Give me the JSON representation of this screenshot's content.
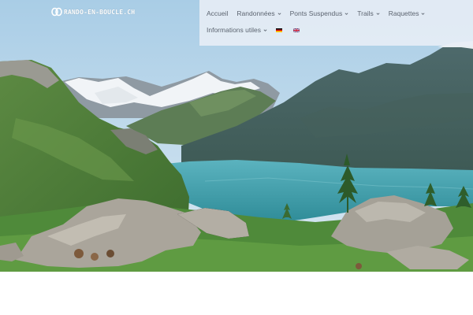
{
  "site": {
    "logo_text": "RANDO-EN-BOUCLE.CH",
    "logo_icon": "loop-logo-icon"
  },
  "nav": {
    "items": [
      {
        "label": "Accueil",
        "has_submenu": false
      },
      {
        "label": "Randonnées",
        "has_submenu": true
      },
      {
        "label": "Ponts Suspendus",
        "has_submenu": true
      },
      {
        "label": "Trails",
        "has_submenu": true
      },
      {
        "label": "Raquettes",
        "has_submenu": true
      },
      {
        "label": "Informations utiles",
        "has_submenu": true
      }
    ],
    "languages": [
      {
        "code": "de",
        "icon": "german-flag-icon"
      },
      {
        "code": "en",
        "icon": "uk-flag-icon"
      }
    ]
  },
  "hero": {
    "image": "alpine-lake-landscape",
    "colors": {
      "sky": "#b9d6ea",
      "lake": "#4aa3ad",
      "grass": "#4f8a3a",
      "rock": "#a9a49a"
    }
  }
}
